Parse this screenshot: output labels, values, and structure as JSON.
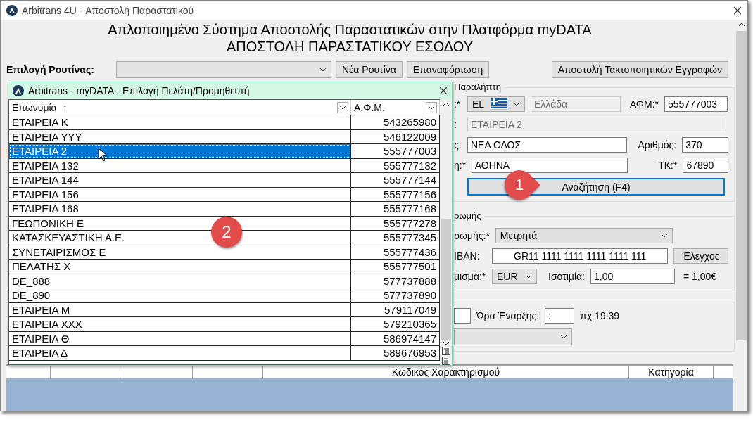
{
  "window": {
    "title": "Arbitrans 4U - Αποστολή Παραστατικού"
  },
  "heading": {
    "line_1": "Απλοποιημένο Σύστημα Αποστολής Παραστατικών στην Πλατφόρμα myDATA",
    "line_2": "ΑΠΟΣΤΟΛΗ ΠΑΡΑΣΤΑΤΙΚΟΥ ΕΣΟΔΟΥ"
  },
  "toolbar": {
    "routine_label": "Επιλογή Ρουτίνας:",
    "buttons": [
      "Νέα Ρουτίνα",
      "Επαναφόρτωση"
    ],
    "right_button": "Αποστολή Τακτοποιητικών Εγγραφών"
  },
  "recipient": {
    "group_title": "Παραλήπτη",
    "country_label": ":*",
    "country_code": "EL",
    "country_name": "Ελλάδα",
    "afm_label": "ΑΦΜ:*",
    "afm": "555777003",
    "name_label": ":",
    "name": "ΕΤΑΙΡΕΙΑ 2",
    "street_label": "ς:",
    "street": "ΝΕΑ ΟΔΟΣ",
    "number_label": "Αριθμός:",
    "number": "370",
    "city_label": "η:*",
    "city": "ΑΘΗΝΑ",
    "zip_label": "ΤΚ:*",
    "zip": "67890",
    "search_button": "Αναζήτηση (F4)"
  },
  "payment": {
    "group_title": "ρωμής",
    "method_label": "ρωμής:*",
    "method": "Μετρητά",
    "iban_label": "IBAN:",
    "iban": "GR11 1111 1111 1111 1111 111",
    "check_button": "Έλεγχος",
    "currency_label": "μισμα:*",
    "currency": "EUR",
    "rate_label": "Ισοτιμία:",
    "rate": "1,00",
    "rate_result": "= 1,00€"
  },
  "timing": {
    "start_time_label": "Ώρα Έναρξης:",
    "start_time": ":",
    "hint": "πχ 19:39"
  },
  "lines_table": {
    "columns": [
      "Κωδικός Χαρακτηρισμού",
      "Κατηγορία"
    ]
  },
  "dialog": {
    "title": "Arbitrans - myDATA - Επιλογή Πελάτη/Προμηθευτή",
    "columns": [
      "Επωνυμία",
      "Α.Φ.Μ."
    ],
    "sort_mark": "↑",
    "rows": [
      {
        "name": "ΕΤΑΙΡΕΙΑ Κ",
        "afm": "543265980",
        "selected": false
      },
      {
        "name": "ΕΤΑΙΡΕΙΑ ΥΥΥ",
        "afm": "546122009",
        "selected": false
      },
      {
        "name": "ΕΤΑΙΡΕΙΑ 2",
        "afm": "555777003",
        "selected": true
      },
      {
        "name": "ΕΤΑΙΡΕΙΑ 132",
        "afm": "555777132",
        "selected": false
      },
      {
        "name": "ΕΤΑΙΡΕΙΑ 144",
        "afm": "555777144",
        "selected": false
      },
      {
        "name": "ΕΤΑΙΡΕΙΑ 156",
        "afm": "555777156",
        "selected": false
      },
      {
        "name": "ΕΤΑΙΡΕΙΑ 168",
        "afm": "555777168",
        "selected": false
      },
      {
        "name": "ΓΕΩΠΟΝΙΚΗ Ε",
        "afm": "555777278",
        "selected": false
      },
      {
        "name": "ΚΑΤΑΣΚΕΥΑΣΤΙΚΗ Α.Ε.",
        "afm": "555777345",
        "selected": false
      },
      {
        "name": "ΣΥΝΕΤΑΙΡΙΣΜΟΣ Ε",
        "afm": "555777436",
        "selected": false
      },
      {
        "name": "ΠΕΛΑΤΗΣ Χ",
        "afm": "555777501",
        "selected": false
      },
      {
        "name": "DE_888",
        "afm": "577737888",
        "selected": false
      },
      {
        "name": "DE_890",
        "afm": "577737890",
        "selected": false
      },
      {
        "name": "ΕΤΑΙΡΕΙΑ Μ",
        "afm": "579117049",
        "selected": false
      },
      {
        "name": "ΕΤΑΙΡΕΙΑ ΧΧΧ",
        "afm": "579210365",
        "selected": false
      },
      {
        "name": "ΕΤΑΙΡΕΙΑ Θ",
        "afm": "586974147",
        "selected": false
      },
      {
        "name": "ΕΤΑΙΡΕΙΑ Δ",
        "afm": "589676953",
        "selected": false
      }
    ]
  },
  "callouts": [
    {
      "kind": "pointer",
      "number": "1"
    },
    {
      "kind": "circle",
      "number": "2"
    }
  ]
}
